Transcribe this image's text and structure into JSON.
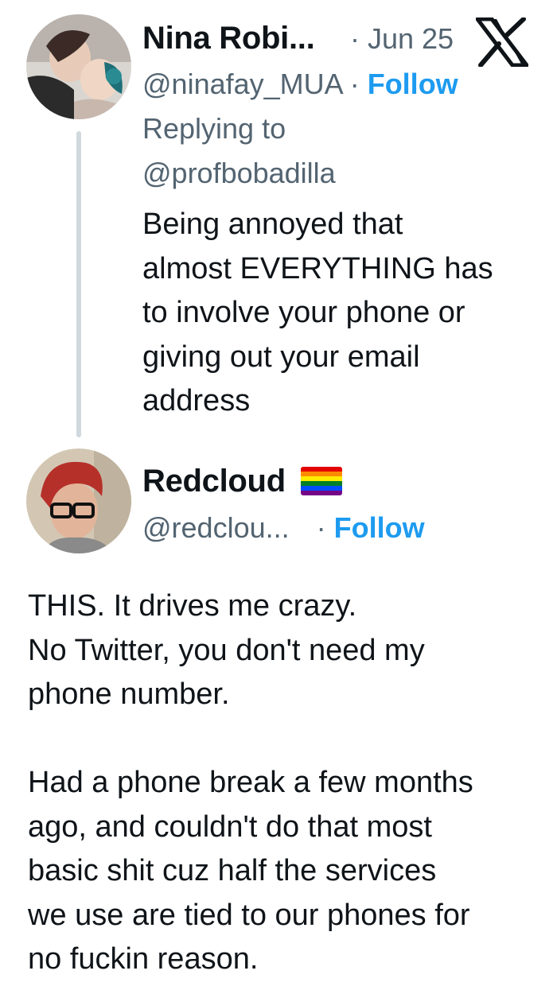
{
  "tweet_reply": {
    "author_name": "Nina Robi...",
    "date": "· Jun 25",
    "handle": "@ninafay_MUA",
    "separator": "·",
    "follow_label": "Follow",
    "replying_to_label": "Replying to",
    "replying_to_handle": "@profbobadilla",
    "text": "Being annoyed that\nalmost EVERYTHING has\nto involve your phone or\ngiving out your email\naddress"
  },
  "quoted_reply": {
    "author_name": "Redcloud",
    "handle": "@redclou...",
    "separator": "·",
    "follow_label": "Follow",
    "badge_icon": "rainbow-flag-emoji",
    "flag_colors": [
      "#e40303",
      "#ff8c00",
      "#ffed00",
      "#008026",
      "#004dff",
      "#750787"
    ]
  },
  "main_text": "THIS. It drives me crazy.\nNo Twitter, you don't need my\nphone number.\n\nHad a phone break a few months\nago, and couldn't do that most\nbasic shit cuz half the services\nwe use are tied to our phones for\nno fuckin reason.",
  "icons": {
    "platform_logo": "x-logo-icon"
  },
  "colors": {
    "accent": "#1d9bf0",
    "muted": "#536471",
    "text": "#0f1419",
    "thread_line": "#cfd9de"
  }
}
